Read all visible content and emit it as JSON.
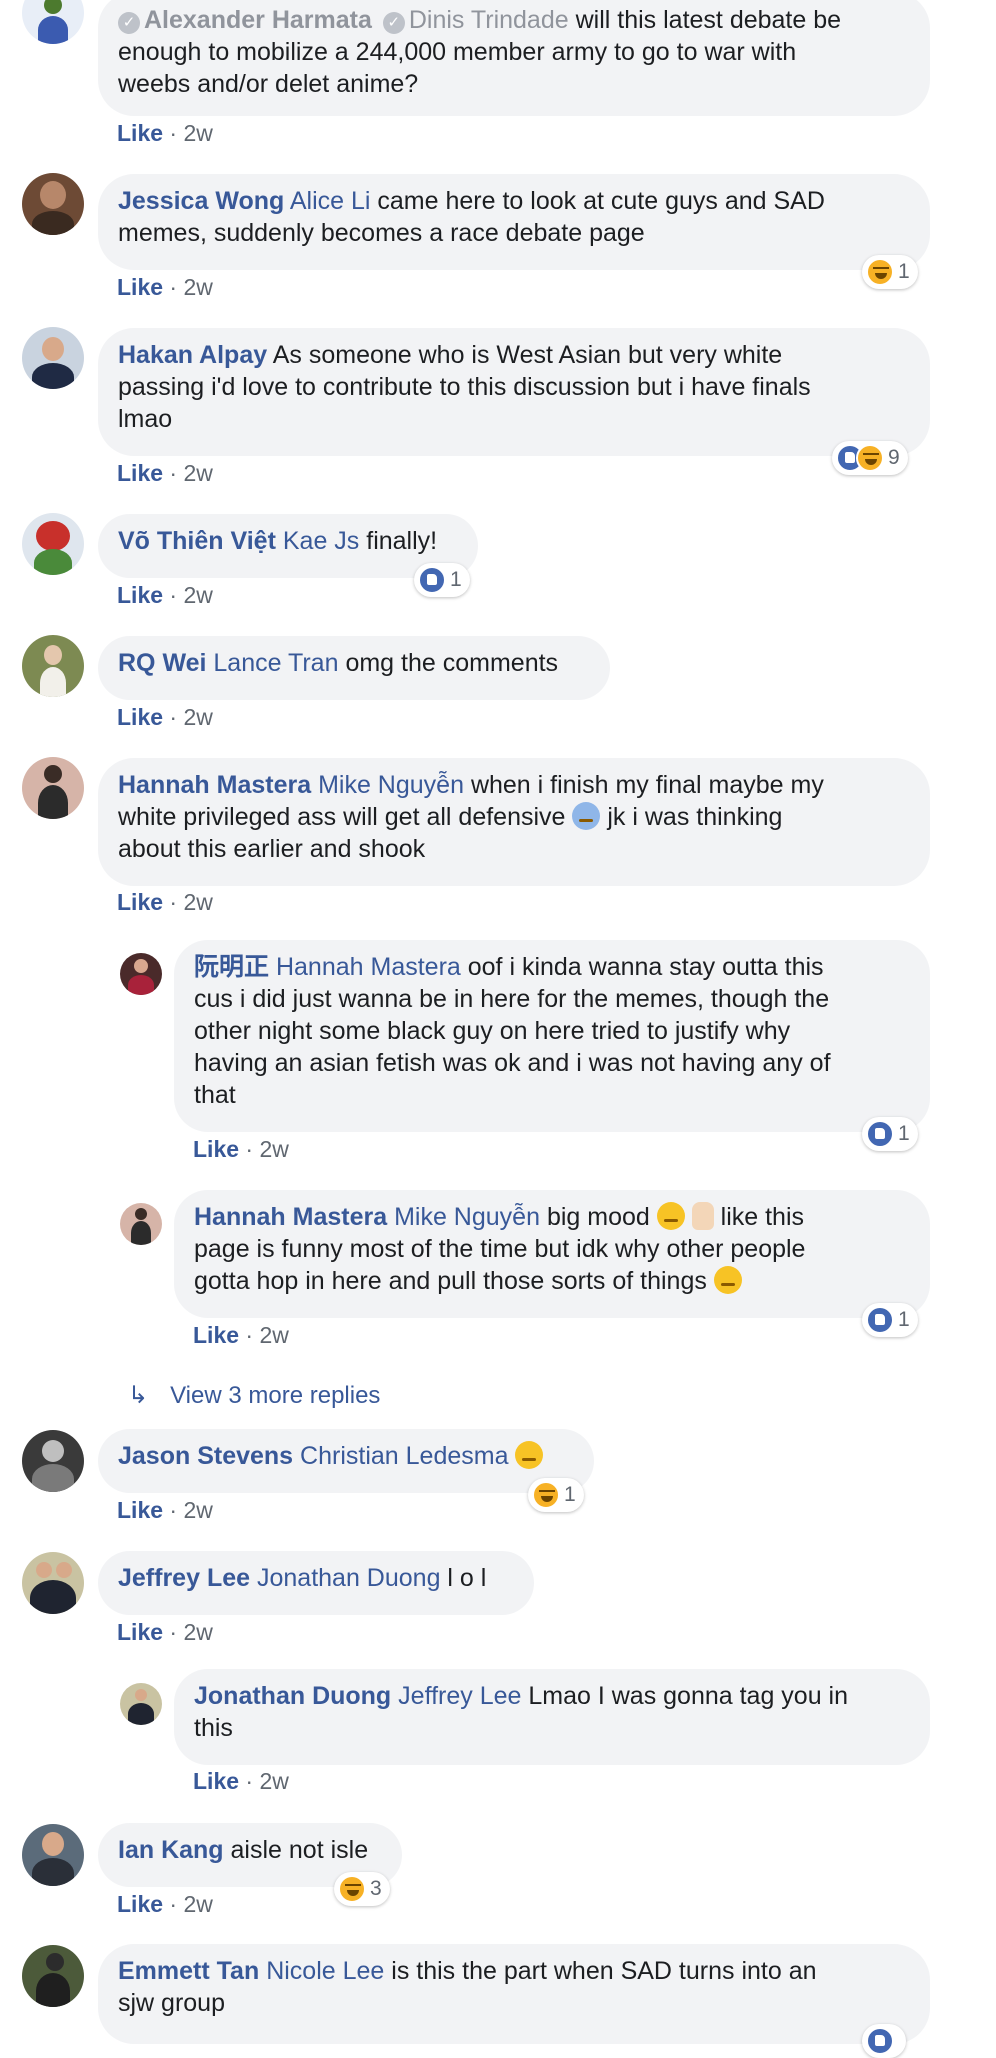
{
  "colors": {
    "link": "#385898",
    "bubble": "#f2f3f5",
    "meta": "#606770",
    "like_blue": "#4267b2",
    "haha_yellow": "#f7b125"
  },
  "comments": [
    {
      "id": "c1",
      "author": "Alexander Harmata",
      "mention": "Dinis Trindade",
      "text_lines": [
        "will this latest debate be",
        "enough to mobilize a 244,000 member army to go to war with",
        "weebs and/or delet anime?"
      ],
      "like": "Like",
      "time": "2w",
      "pending": true
    },
    {
      "id": "c2",
      "author": "Jessica Wong",
      "mention": "Alice Li",
      "text_lines": [
        "came here to look at cute guys and SAD",
        "memes, suddenly becomes a race debate page"
      ],
      "like": "Like",
      "time": "2w",
      "reactions": {
        "icons": [
          "haha-icon"
        ],
        "count": "1"
      }
    },
    {
      "id": "c3",
      "author": "Hakan Alpay",
      "mention": "",
      "text_lines": [
        "As someone who is West Asian but very white",
        "passing i'd love to contribute to this discussion but i have finals",
        "lmao"
      ],
      "like": "Like",
      "time": "2w",
      "reactions": {
        "icons": [
          "like-icon",
          "haha-icon"
        ],
        "count": "9"
      }
    },
    {
      "id": "c4",
      "author": "Võ Thiên Việt",
      "mention": "Kae Js",
      "text_lines": [
        "finally!"
      ],
      "like": "Like",
      "time": "2w",
      "reactions": {
        "icons": [
          "like-icon"
        ],
        "count": "1"
      }
    },
    {
      "id": "c5",
      "author": "RQ Wei",
      "mention": "Lance Tran",
      "text_lines": [
        "omg the comments"
      ],
      "like": "Like",
      "time": "2w"
    },
    {
      "id": "c6",
      "author": "Hannah Mastera",
      "mention": "Mike Nguyễn",
      "text_lines": [
        "when i finish my final maybe my",
        "white privileged ass will get all defensive",
        "jk i was thinking",
        "about this earlier and shook"
      ],
      "like": "Like",
      "time": "2w"
    },
    {
      "id": "r1",
      "author": "阮明正",
      "mention": "Hannah Mastera",
      "text_lines": [
        "oof i kinda wanna stay outta this",
        "cus i did just wanna be in here for the memes, though the",
        "other night some black guy on here tried to justify why",
        "having an asian fetish was ok and i was not having any of",
        "that"
      ],
      "like": "Like",
      "time": "2w",
      "reactions": {
        "icons": [
          "like-icon"
        ],
        "count": "1"
      }
    },
    {
      "id": "r2",
      "author": "Hannah Mastera",
      "mention": "Mike Nguyễn",
      "text_lines": [
        "big mood",
        "like this",
        "page is funny most of the time but idk why other people",
        "gotta hop in here and pull those sorts of things"
      ],
      "like": "Like",
      "time": "2w",
      "reactions": {
        "icons": [
          "like-icon"
        ],
        "count": "1"
      }
    },
    {
      "id": "c7",
      "author": "Jason Stevens",
      "mention": "Christian Ledesma",
      "text_lines": [
        ""
      ],
      "like": "Like",
      "time": "2w",
      "reactions": {
        "icons": [
          "haha-icon"
        ],
        "count": "1"
      }
    },
    {
      "id": "c8",
      "author": "Jeffrey Lee",
      "mention": "Jonathan Duong",
      "text_lines": [
        "l o l"
      ],
      "like": "Like",
      "time": "2w"
    },
    {
      "id": "r3",
      "author": "Jonathan Duong",
      "mention": "Jeffrey Lee",
      "text_lines": [
        "Lmao I was gonna tag you in",
        "this"
      ],
      "like": "Like",
      "time": "2w"
    },
    {
      "id": "c9",
      "author": "Ian Kang",
      "mention": "",
      "text_lines": [
        "aisle not isle"
      ],
      "like": "Like",
      "time": "2w",
      "reactions": {
        "icons": [
          "haha-icon"
        ],
        "count": "3"
      }
    },
    {
      "id": "c10",
      "author": "Emmett Tan",
      "mention": "Nicole Lee",
      "text_lines": [
        "is this the part when SAD turns into an",
        "sjw group"
      ]
    }
  ],
  "view_more": "View 3 more replies",
  "separator": "·"
}
